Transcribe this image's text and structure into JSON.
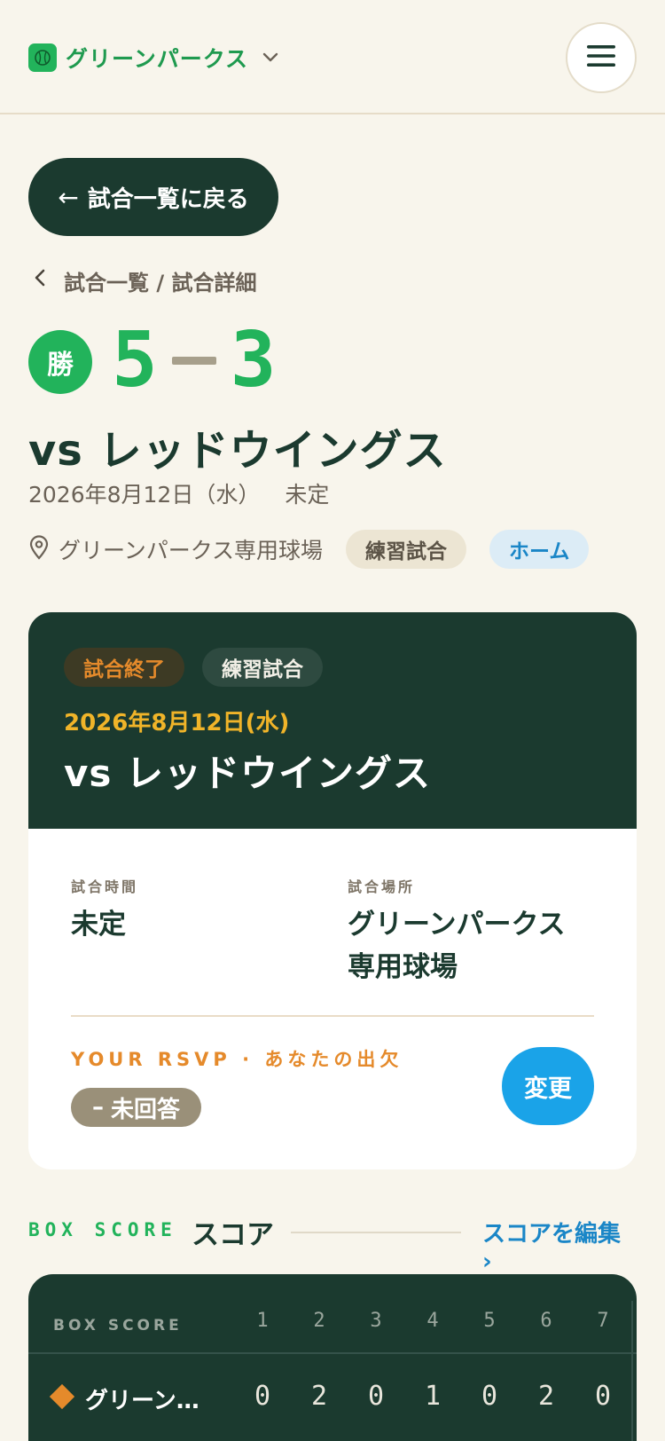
{
  "header": {
    "team_name": "グリーンパークス",
    "team_logo_icon": "baseball-icon",
    "chevron_icon": "chevron-down-icon",
    "menu_icon": "hamburger-icon"
  },
  "back_button": {
    "arrow": "←",
    "label": "試合一覧に戻る"
  },
  "breadcrumb": {
    "back_icon": "chevron-left-icon",
    "path": "試合一覧 / 試合詳細"
  },
  "result": {
    "badge": "勝",
    "home_score": "5",
    "away_score": "3"
  },
  "game": {
    "opponent": "vs レッドウイングス",
    "date": "2026年8月12日（水）",
    "time": "未定",
    "venue": "グリーンパークス専用球場",
    "venue_icon": "map-pin-icon",
    "type_tag": "練習試合",
    "home_tag": "ホーム"
  },
  "card": {
    "status": "試合終了",
    "type": "練習試合",
    "date": "2026年8月12日(水)",
    "opponent": "vs レッドウイングス",
    "time_label": "試合時間",
    "time_value": "未定",
    "place_label": "試合場所",
    "place_line1": "グリーンパークス",
    "place_line2": "専用球場",
    "rsvp_label": "YOUR RSVP · あなたの出欠",
    "rsvp_dash": "–",
    "rsvp_status": "未回答",
    "rsvp_change": "変更"
  },
  "box_score": {
    "eyebrow": "BOX SCORE",
    "title": "スコア",
    "edit_link": "スコアを編集 ›",
    "table_label": "BOX SCORE",
    "innings": [
      "1",
      "2",
      "3",
      "4",
      "5",
      "6",
      "7"
    ],
    "rows": [
      {
        "team": "グリーン…",
        "scores": [
          "0",
          "2",
          "0",
          "1",
          "0",
          "2",
          "0"
        ]
      }
    ]
  },
  "colors": {
    "background": "#f8f5ec",
    "dark_green": "#1b3a2f",
    "accent_green": "#22b35b",
    "orange": "#e58a2b",
    "yellow": "#f0b429",
    "blue": "#1aa3e8",
    "link_blue": "#1a86c7"
  }
}
